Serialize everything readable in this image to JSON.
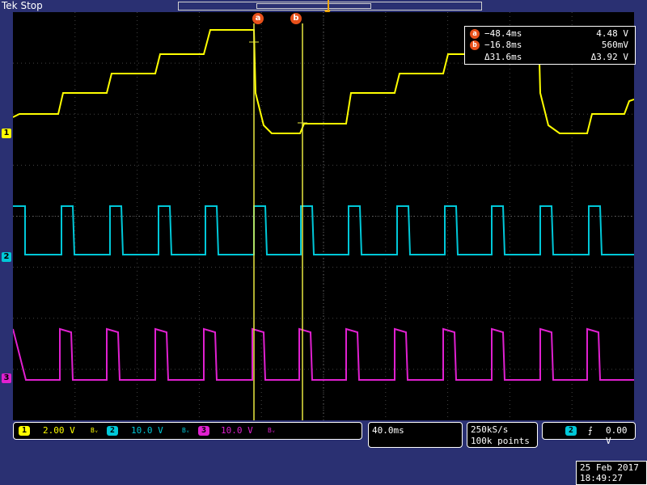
{
  "header": {
    "brand": "Tek",
    "status": "Stop"
  },
  "colors": {
    "ch1": "#ffff00",
    "ch2": "#00c8d8",
    "ch3": "#e020d0",
    "cursor": "#e8e840",
    "cursor_badge": "#e8501a",
    "trigger": "#f0a500",
    "screen_bg": "#000000",
    "frame_bg": "#2a3072"
  },
  "channels": {
    "ch1_label": "1",
    "ch2_label": "2",
    "ch3_label": "3"
  },
  "cursors": {
    "a_label": "a",
    "b_label": "b"
  },
  "readout": {
    "a_time": "−48.4ms",
    "a_value": "4.48 V",
    "b_time": "−16.8ms",
    "b_value": "560mV",
    "delta_time": "Δ31.6ms",
    "delta_value": "Δ3.92 V"
  },
  "scales": {
    "ch1": "2.00 V",
    "ch2": "10.0 V",
    "ch3": "10.0 V",
    "bw_symbol": "Bᵥ"
  },
  "timebase": {
    "per_div": "40.0ms",
    "sample_rate": "250kS/s",
    "record_length": "100k points"
  },
  "trigger": {
    "source": "2",
    "slope_icon": "rising-edge-icon",
    "level": "0.00 V"
  },
  "datetime": {
    "date": "25 Feb  2017",
    "time": "18:49:27"
  }
}
